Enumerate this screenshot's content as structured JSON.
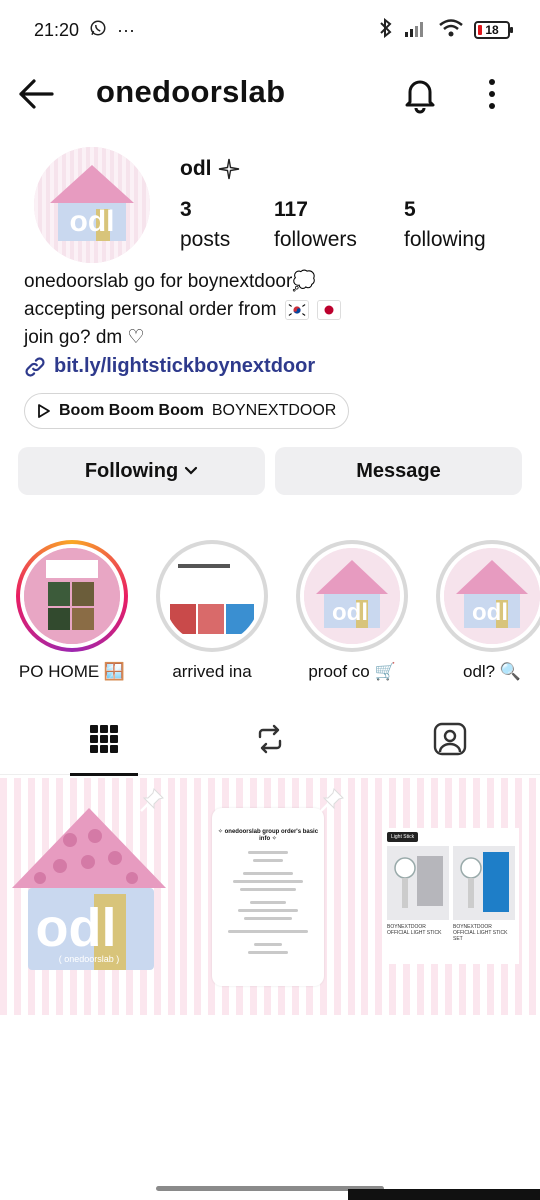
{
  "status_bar": {
    "time": "21:20",
    "more": "···",
    "battery": "18"
  },
  "header": {
    "username": "onedoorslab"
  },
  "profile": {
    "display_name": "odl",
    "stats": [
      {
        "value": "3",
        "label": "posts"
      },
      {
        "value": "117",
        "label": "followers"
      },
      {
        "value": "5",
        "label": "following"
      }
    ],
    "bio_line1": "onedoorslab go for boynextdoor💭",
    "bio_line2": "accepting personal order from",
    "bio_line3": "join go? dm ♡",
    "link": "bit.ly/lightstickboynextdoor",
    "music_song": "Boom Boom Boom",
    "music_artist": "BOYNEXTDOOR",
    "avatar_text": "odl"
  },
  "buttons": {
    "following": "Following",
    "message": "Message"
  },
  "highlights": [
    {
      "label": "PO HOME 🪟"
    },
    {
      "label": "arrived ina"
    },
    {
      "label": "proof co 🛒"
    },
    {
      "label": "odl? 🔍"
    }
  ],
  "posts": {
    "post1": {
      "logo": "odl",
      "caption": "( onedoorslab )"
    },
    "post2": {
      "title": "✧ onedoorslab group order's basic info ✧"
    },
    "post3": {
      "tag": "Light Stick",
      "left_caption": "BOYNEXTDOOR OFFICIAL LIGHT STICK",
      "right_caption": "BOYNEXTDOOR OFFICIAL LIGHT STICK SET"
    }
  },
  "colors": {
    "accent_link": "#2e3a8c",
    "house_pink": "#e79bc0",
    "house_blue": "#c9d8ef",
    "door_gold": "#d8c47a"
  }
}
